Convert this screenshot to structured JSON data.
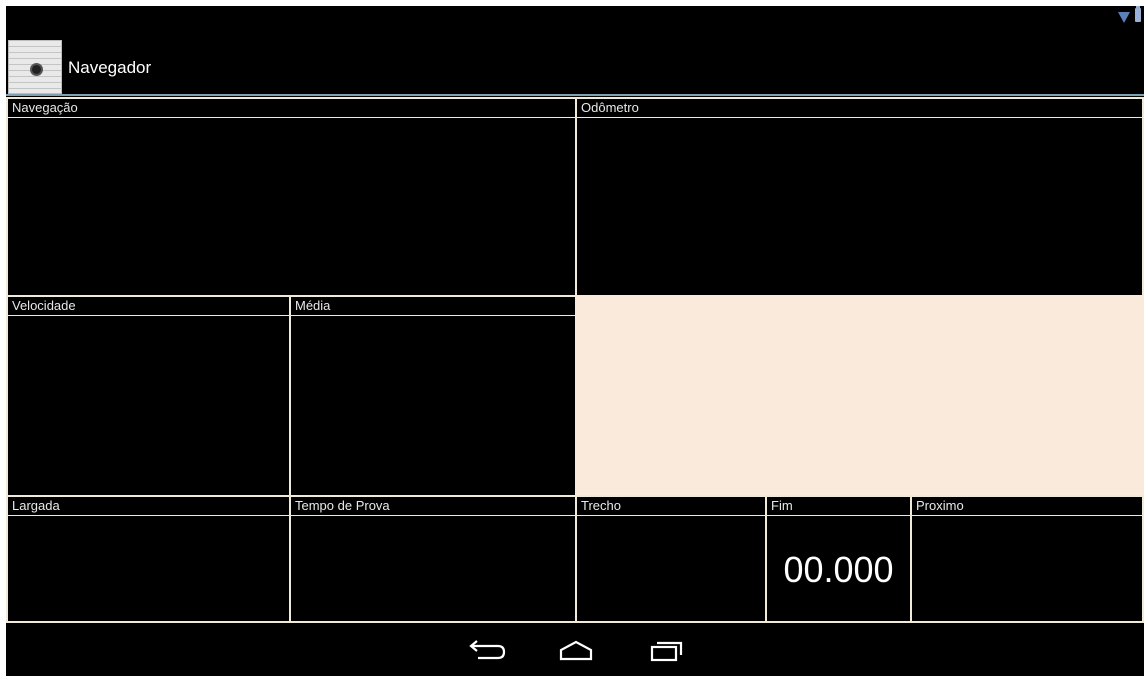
{
  "app": {
    "title": "Navegador",
    "icon": "app-list-icon"
  },
  "status_bar": {
    "icons": [
      "wifi-icon",
      "battery-charging-icon"
    ],
    "colors": {
      "wifi": "#5b7fb8",
      "battery": "#9ab0d8"
    }
  },
  "panels": {
    "navegacao": {
      "label": "Navegação",
      "value": ""
    },
    "odometro": {
      "label": "Odômetro",
      "value": ""
    },
    "velocidade": {
      "label": "Velocidade",
      "value": ""
    },
    "media": {
      "label": "Média",
      "value": ""
    },
    "largada": {
      "label": "Largada",
      "value": ""
    },
    "tempo_de_prova": {
      "label": "Tempo de Prova",
      "value": ""
    },
    "trecho": {
      "label": "Trecho",
      "value": ""
    },
    "fim": {
      "label": "Fim",
      "value": "00.000"
    },
    "proximo": {
      "label": "Proximo",
      "value": ""
    }
  },
  "nav_bar": {
    "buttons": [
      "back-icon",
      "home-icon",
      "recents-icon"
    ]
  },
  "colors": {
    "background": "#000000",
    "panel_border": "#f2ead8",
    "blank_panel": "#faeadb",
    "action_bar_divider": "#7f9fb5",
    "text": "#ffffff"
  }
}
